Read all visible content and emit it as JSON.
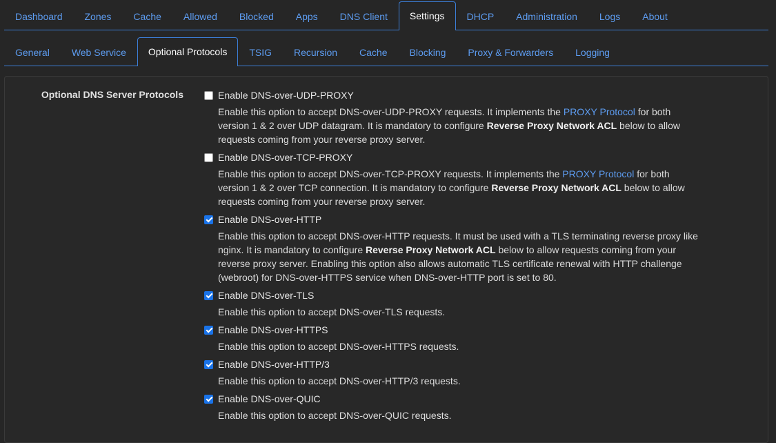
{
  "main_tabs": [
    "Dashboard",
    "Zones",
    "Cache",
    "Allowed",
    "Blocked",
    "Apps",
    "DNS Client",
    "Settings",
    "DHCP",
    "Administration",
    "Logs",
    "About"
  ],
  "main_active": "Settings",
  "sub_tabs": [
    "General",
    "Web Service",
    "Optional Protocols",
    "TSIG",
    "Recursion",
    "Cache",
    "Blocking",
    "Proxy & Forwarders",
    "Logging"
  ],
  "sub_active": "Optional Protocols",
  "group_label": "Optional DNS Server Protocols",
  "options": [
    {
      "label": "Enable DNS-over-UDP-PROXY",
      "checked": false,
      "desc": {
        "t1": "Enable this option to accept DNS-over-UDP-PROXY requests. It implements the ",
        "link": "PROXY Protocol",
        "t2": " for both version 1 & 2 over UDP datagram. It is mandatory to configure ",
        "bold": "Reverse Proxy Network ACL",
        "t3": " below to allow requests coming from your reverse proxy server."
      }
    },
    {
      "label": "Enable DNS-over-TCP-PROXY",
      "checked": false,
      "desc": {
        "t1": "Enable this option to accept DNS-over-TCP-PROXY requests. It implements the ",
        "link": "PROXY Protocol",
        "t2": " for both version 1 & 2 over TCP connection. It is mandatory to configure ",
        "bold": "Reverse Proxy Network ACL",
        "t3": " below to allow requests coming from your reverse proxy server."
      }
    },
    {
      "label": "Enable DNS-over-HTTP",
      "checked": true,
      "desc": {
        "t1": "Enable this option to accept DNS-over-HTTP requests. It must be used with a TLS terminating reverse proxy like nginx. It is mandatory to configure ",
        "bold": "Reverse Proxy Network ACL",
        "t3": " below to allow requests coming from your reverse proxy server. Enabling this option also allows automatic TLS certificate renewal with HTTP challenge (webroot) for DNS-over-HTTPS service when DNS-over-HTTP port is set to 80."
      }
    },
    {
      "label": "Enable DNS-over-TLS",
      "checked": true,
      "desc": {
        "t1": "Enable this option to accept DNS-over-TLS requests."
      }
    },
    {
      "label": "Enable DNS-over-HTTPS",
      "checked": true,
      "desc": {
        "t1": "Enable this option to accept DNS-over-HTTPS requests."
      }
    },
    {
      "label": "Enable DNS-over-HTTP/3",
      "checked": true,
      "desc": {
        "t1": "Enable this option to accept DNS-over-HTTP/3 requests."
      }
    },
    {
      "label": "Enable DNS-over-QUIC",
      "checked": true,
      "desc": {
        "t1": "Enable this option to accept DNS-over-QUIC requests."
      }
    }
  ],
  "colors": {
    "accent": "#5d9cf0",
    "checkbox": "#1a73e8",
    "background": "#262626"
  }
}
